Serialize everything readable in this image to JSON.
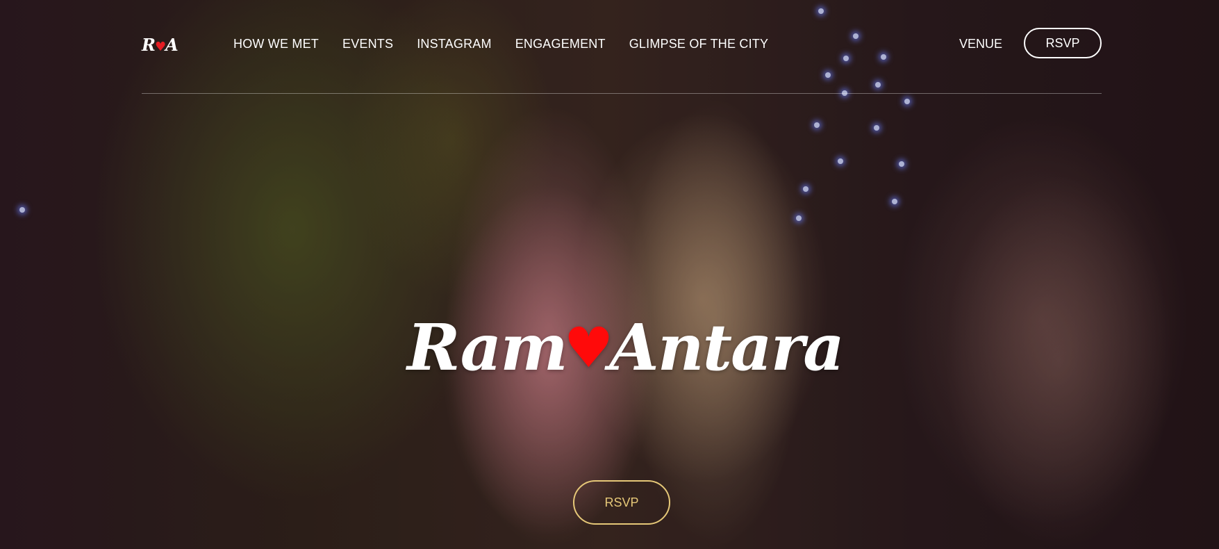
{
  "logo": {
    "left": "R",
    "heart": "♥",
    "right": "A"
  },
  "nav": {
    "links": [
      "HOW WE MET",
      "EVENTS",
      "INSTAGRAM",
      "ENGAGEMENT",
      "GLIMPSE OF THE CITY"
    ],
    "venue": "VENUE",
    "rsvp": "RSVP"
  },
  "hero": {
    "name_left": "Ram",
    "heart": "♥",
    "name_right": "Antara",
    "rsvp": "RSVP",
    "heart_color": "#ff0a0a",
    "rsvp_color": "#e6c878"
  }
}
